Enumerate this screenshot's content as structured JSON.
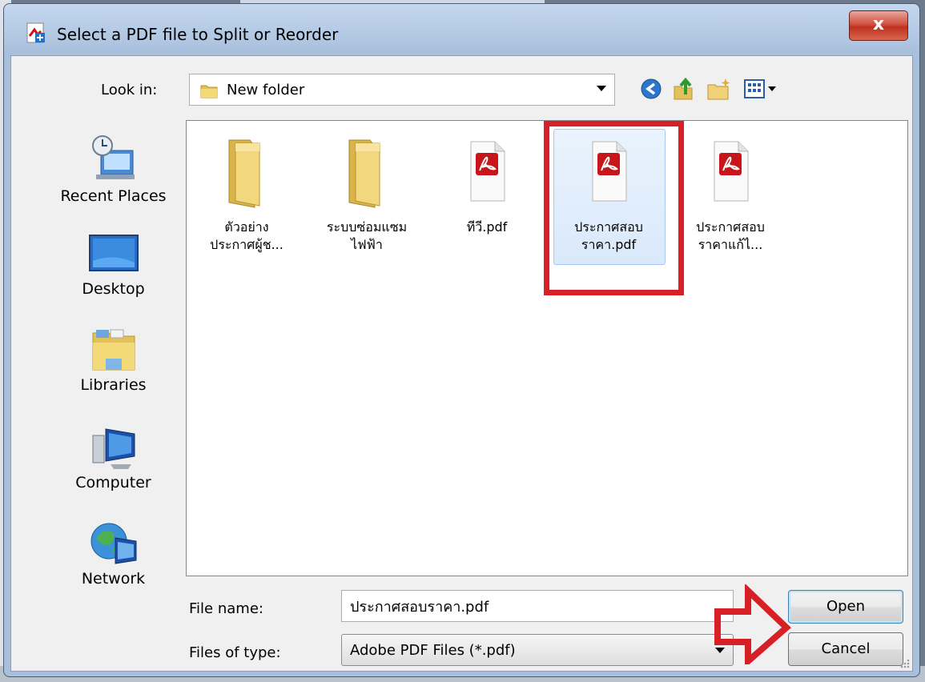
{
  "window": {
    "title": "Select a PDF file to Split or Reorder",
    "close_label": "x"
  },
  "lookin": {
    "label": "Look in:",
    "value": "New folder"
  },
  "places": [
    {
      "label": "Recent Places",
      "icon": "recent-places-icon"
    },
    {
      "label": "Desktop",
      "icon": "desktop-icon"
    },
    {
      "label": "Libraries",
      "icon": "libraries-icon"
    },
    {
      "label": "Computer",
      "icon": "computer-icon"
    },
    {
      "label": "Network",
      "icon": "network-icon"
    }
  ],
  "files": [
    {
      "line1": "ตัวอย่าง",
      "line2": "ประกาศผู้ช...",
      "type": "folder"
    },
    {
      "line1": "ระบบซ่อมแซม",
      "line2": "ไฟฟ้า",
      "type": "folder"
    },
    {
      "line1": "ทีวี.pdf",
      "line2": "",
      "type": "pdf"
    },
    {
      "line1": "ประกาศสอบ",
      "line2": "ราคา.pdf",
      "type": "pdf",
      "selected": true
    },
    {
      "line1": "ประกาศสอบ",
      "line2": "ราคาแก้ไ...",
      "type": "pdf"
    }
  ],
  "filename": {
    "label": "File name:",
    "value": "ประกาศสอบราคา.pdf"
  },
  "filetype": {
    "label": "Files of type:",
    "value": "Adobe PDF Files (*.pdf)"
  },
  "buttons": {
    "open": "Open",
    "cancel": "Cancel"
  },
  "colors": {
    "highlight_red": "#d71f26",
    "selection_blue": "#d9e8fb",
    "pdf_red": "#c8151b"
  }
}
